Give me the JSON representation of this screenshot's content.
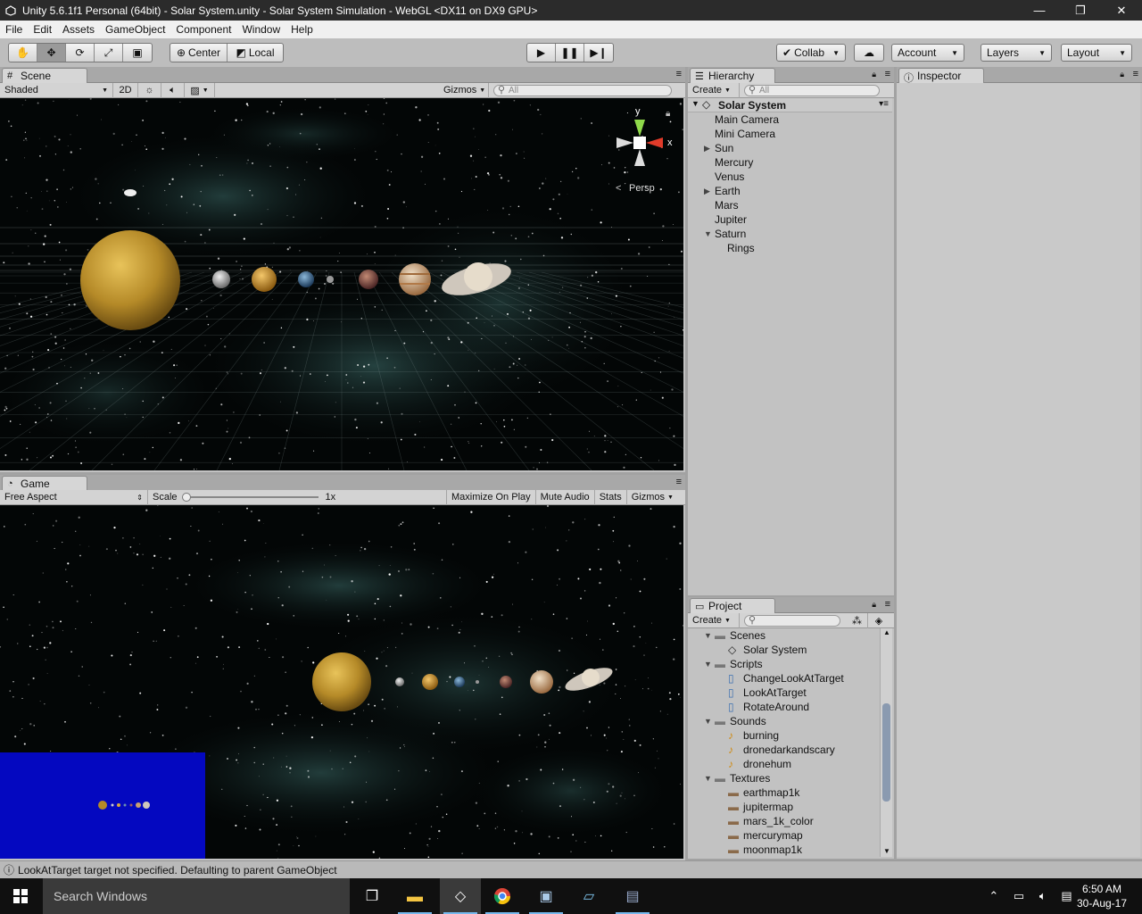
{
  "window": {
    "title": "Unity 5.6.1f1 Personal (64bit) - Solar System.unity - Solar System Simulation - WebGL <DX11 on DX9 GPU>",
    "minimize": "—",
    "restore": "❐",
    "close": "✕"
  },
  "menu": [
    "File",
    "Edit",
    "Assets",
    "GameObject",
    "Component",
    "Window",
    "Help"
  ],
  "toolbar": {
    "pivot": "Center",
    "space": "Local",
    "collab": "Collab",
    "account": "Account",
    "layers": "Layers",
    "layout": "Layout"
  },
  "scene": {
    "tab": "Scene",
    "shading": "Shaded",
    "mode2d": "2D",
    "gizmos": "Gizmos",
    "search_placeholder": "All",
    "gizmo": {
      "y": "y",
      "x": "x",
      "persp": "Persp"
    }
  },
  "game": {
    "tab": "Game",
    "aspect": "Free Aspect",
    "scale_label": "Scale",
    "scale_value": "1x",
    "maximize": "Maximize On Play",
    "mute": "Mute Audio",
    "stats": "Stats",
    "gizmos": "Gizmos"
  },
  "hierarchy": {
    "tab": "Hierarchy",
    "create": "Create",
    "search_placeholder": "All",
    "scene_root": "Solar System",
    "items": [
      {
        "label": "Main Camera",
        "expander": ""
      },
      {
        "label": "Mini Camera",
        "expander": ""
      },
      {
        "label": "Sun",
        "expander": "▶"
      },
      {
        "label": "Mercury",
        "expander": ""
      },
      {
        "label": "Venus",
        "expander": ""
      },
      {
        "label": "Earth",
        "expander": "▶"
      },
      {
        "label": "Mars",
        "expander": ""
      },
      {
        "label": "Jupiter",
        "expander": ""
      },
      {
        "label": "Saturn",
        "expander": "▼"
      },
      {
        "label": "Rings",
        "expander": ""
      }
    ]
  },
  "inspector": {
    "tab": "Inspector"
  },
  "project": {
    "tab": "Project",
    "create": "Create",
    "folders": [
      {
        "name": "Scenes",
        "items": [
          {
            "label": "Solar System",
            "icon": "unity-scene-icon"
          }
        ]
      },
      {
        "name": "Scripts",
        "items": [
          {
            "label": "ChangeLookAtTarget",
            "icon": "script-icon"
          },
          {
            "label": "LookAtTarget",
            "icon": "script-icon"
          },
          {
            "label": "RotateAround",
            "icon": "script-icon"
          }
        ]
      },
      {
        "name": "Sounds",
        "items": [
          {
            "label": "burning",
            "icon": "audio-icon"
          },
          {
            "label": "dronedarkandscary",
            "icon": "audio-icon"
          },
          {
            "label": "dronehum",
            "icon": "audio-icon"
          }
        ]
      },
      {
        "name": "Textures",
        "items": [
          {
            "label": "earthmap1k",
            "icon": "texture-icon"
          },
          {
            "label": "jupitermap",
            "icon": "texture-icon"
          },
          {
            "label": "mars_1k_color",
            "icon": "texture-icon"
          },
          {
            "label": "mercurymap",
            "icon": "texture-icon"
          },
          {
            "label": "moonmap1k",
            "icon": "texture-icon"
          }
        ]
      }
    ]
  },
  "status": {
    "message": "LookAtTarget target not specified. Defaulting to parent GameObject"
  },
  "taskbar": {
    "search": "Search Windows",
    "time": "6:50 AM",
    "date": "30-Aug-17"
  }
}
